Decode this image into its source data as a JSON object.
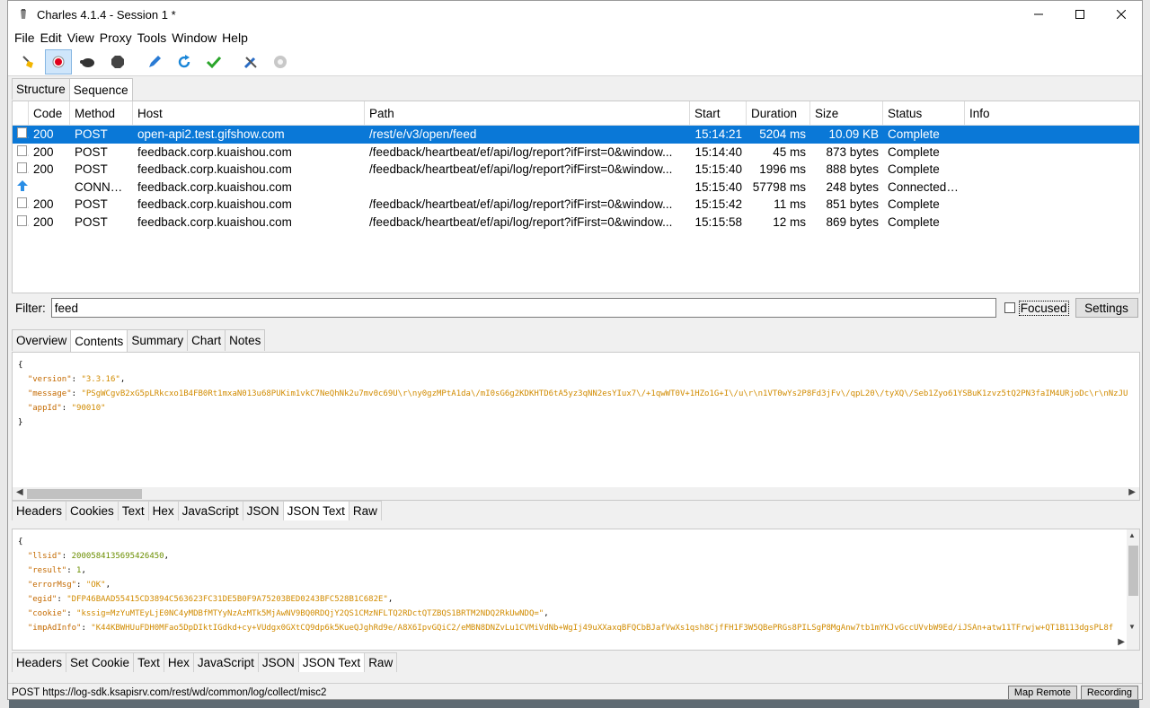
{
  "window": {
    "title": "Charles 4.1.4 - Session 1 *"
  },
  "menu": [
    "File",
    "Edit",
    "View",
    "Proxy",
    "Tools",
    "Window",
    "Help"
  ],
  "top_tabs": [
    "Structure",
    "Sequence"
  ],
  "table": {
    "columns": [
      "Code",
      "Method",
      "Host",
      "Path",
      "Start",
      "Duration",
      "Size",
      "Status",
      "Info"
    ],
    "rows": [
      [
        "200",
        "POST",
        "open-api2.test.gifshow.com",
        "/rest/e/v3/open/feed",
        "15:14:21",
        "5204 ms",
        "10.09 KB",
        "Complete",
        ""
      ],
      [
        "200",
        "POST",
        "feedback.corp.kuaishou.com",
        "/feedback/heartbeat/ef/api/log/report?ifFirst=0&window...",
        "15:14:40",
        "45 ms",
        "873 bytes",
        "Complete",
        ""
      ],
      [
        "200",
        "POST",
        "feedback.corp.kuaishou.com",
        "/feedback/heartbeat/ef/api/log/report?ifFirst=0&window...",
        "15:15:40",
        "1996 ms",
        "888 bytes",
        "Complete",
        ""
      ],
      [
        "",
        "CONNECT",
        "feedback.corp.kuaishou.com",
        "",
        "15:15:40",
        "57798 ms",
        "248 bytes",
        "Connected t...",
        ""
      ],
      [
        "200",
        "POST",
        "feedback.corp.kuaishou.com",
        "/feedback/heartbeat/ef/api/log/report?ifFirst=0&window...",
        "15:15:42",
        "11 ms",
        "851 bytes",
        "Complete",
        ""
      ],
      [
        "200",
        "POST",
        "feedback.corp.kuaishou.com",
        "/feedback/heartbeat/ef/api/log/report?ifFirst=0&window...",
        "15:15:58",
        "12 ms",
        "869 bytes",
        "Complete",
        ""
      ]
    ]
  },
  "filter": {
    "label": "Filter:",
    "value": "feed",
    "focused": "Focused",
    "settings": "Settings"
  },
  "detail_tabs": [
    "Overview",
    "Contents",
    "Summary",
    "Chart",
    "Notes"
  ],
  "request_json": {
    "version_key": "\"version\"",
    "version_val": "\"3.3.16\"",
    "message_key": "\"message\"",
    "message_val": "\"PSgWCgvB2xG5pLRkcxo1B4FB0Rt1mxaN013u68PUKim1vkC7NeQhNk2u7mv0c69U\\r\\ny0gzMPtA1da\\/mI0sG6g2KDKHTD6tA5yz3qNN2esYIux7\\/+1qwWT0V+1HZo1G+I\\/u\\r\\n1VT0wYs2P8Fd3jFv\\/qpL20\\/tyXQ\\/Seb1Zyo61YSBuK1zvz5tQ2PN3faIM4URjoDc\\r\\nNzJU",
    "appid_key": "\"appId\"",
    "appid_val": "\"90010\""
  },
  "request_subtabs": [
    "Headers",
    "Cookies",
    "Text",
    "Hex",
    "JavaScript",
    "JSON",
    "JSON Text",
    "Raw"
  ],
  "response_json": {
    "llsid_key": "\"llsid\"",
    "llsid_val": "2000584135695426450",
    "result_key": "\"result\"",
    "result_val": "1",
    "errormsg_key": "\"errorMsg\"",
    "errormsg_val": "\"OK\"",
    "egid_key": "\"egid\"",
    "egid_val": "\"DFP46BAAD55415CD3894C563623FC31DE5B0F9A75203BED0243BFC528B1C682E\"",
    "cookie_key": "\"cookie\"",
    "cookie_val": "\"kssig=MzYuMTEyLjE0NC4yMDBfMTYyNzAzMTk5MjAwNV9BQ0RDQjY2QS1CMzNFLTQ2RDctQTZBQS1BRTM2NDQ2RkUwNDQ=\"",
    "impad_key": "\"impAdInfo\"",
    "impad_val": "\"K44KBWHUuFDH0MFao5DpDIktIGdkd+cy+VUdgx0GXtCQ9dp6k5KueQJghRd9e/A8X6IpvGQiC2/eMBN8DNZvLu1CVMiVdNb+WgIj49uXXaxqBFQCbBJafVwXs1qsh8CjfFH1F3W5QBePRGs8PILSgP8MgAnw7tb1mYKJvGccUVvbW9Ed/iJSAn+atw11TFrwjw+QT1B113dgsPL8f"
  },
  "response_subtabs": [
    "Headers",
    "Set Cookie",
    "Text",
    "Hex",
    "JavaScript",
    "JSON",
    "JSON Text",
    "Raw"
  ],
  "status": {
    "text": "POST https://log-sdk.ksapisrv.com/rest/wd/common/log/collect/misc2",
    "map_remote": "Map Remote",
    "recording": "Recording"
  }
}
